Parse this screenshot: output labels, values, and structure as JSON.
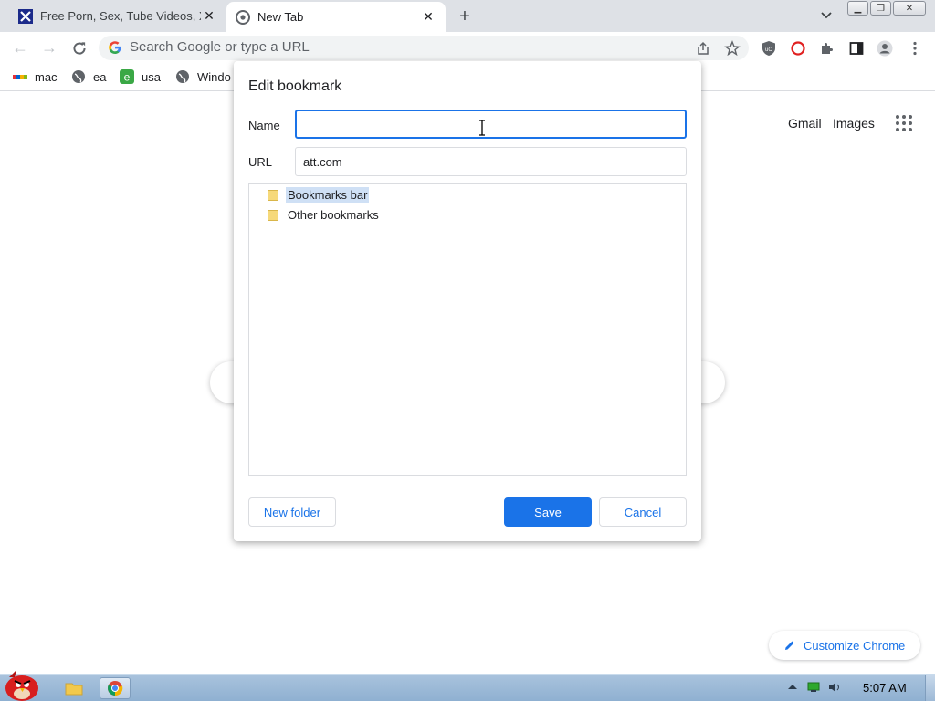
{
  "browser": {
    "tabs": [
      {
        "title": "Free Porn, Sex, Tube Videos, X",
        "active": false
      },
      {
        "title": "New Tab",
        "active": true
      }
    ],
    "new_tab_symbol": "+",
    "omnibox_placeholder": "Search Google or type a URL"
  },
  "bookmarks_bar": [
    {
      "label": "mac"
    },
    {
      "label": "ea"
    },
    {
      "label": "usa"
    },
    {
      "label": "Windo"
    }
  ],
  "ntp": {
    "gmail": "Gmail",
    "images": "Images",
    "customize_label": "Customize Chrome"
  },
  "dialog": {
    "title": "Edit bookmark",
    "name_label": "Name",
    "name_value": "",
    "url_label": "URL",
    "url_value": "att.com",
    "folders": [
      {
        "label": "Bookmarks bar",
        "selected": true
      },
      {
        "label": "Other bookmarks",
        "selected": false
      }
    ],
    "new_folder": "New folder",
    "save": "Save",
    "cancel": "Cancel"
  },
  "taskbar": {
    "clock": "5:07 AM"
  },
  "colors": {
    "accent": "#1a73e8",
    "tabstrip": "#dee1e6",
    "selection": "#cfe0f5"
  }
}
